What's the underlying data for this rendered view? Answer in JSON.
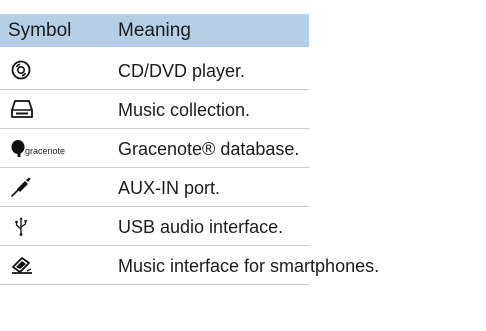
{
  "table": {
    "headers": {
      "symbol": "Symbol",
      "meaning": "Meaning"
    },
    "rows": [
      {
        "icon": "cd-dvd-disc-icon",
        "meaning": "CD/DVD player."
      },
      {
        "icon": "music-collection-hdd-icon",
        "meaning": "Music collection."
      },
      {
        "icon": "gracenote-logo-icon",
        "logo_text": "gracenote",
        "meaning": "Gracenote® database."
      },
      {
        "icon": "aux-in-plug-icon",
        "meaning": "AUX-IN port."
      },
      {
        "icon": "usb-symbol-icon",
        "meaning": "USB audio interface."
      },
      {
        "icon": "smartphone-music-icon",
        "meaning": "Music interface for smartphones."
      }
    ]
  },
  "colors": {
    "header_background": "#b5cfe6",
    "row_divider": "#cfcfcf"
  }
}
